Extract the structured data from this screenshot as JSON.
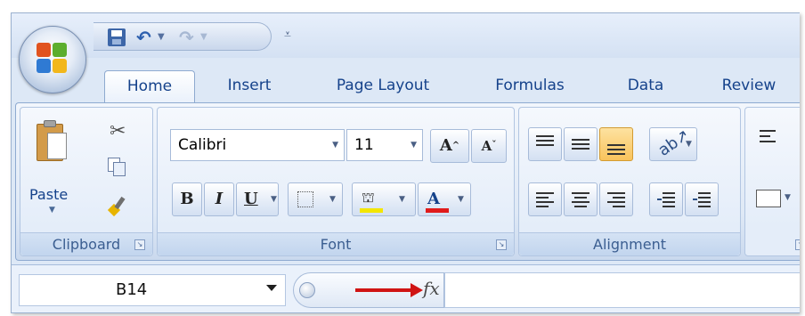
{
  "quick_access": {
    "customize_glyph": "₹"
  },
  "tabs": [
    {
      "label": "Home",
      "active": true
    },
    {
      "label": "Insert",
      "active": false
    },
    {
      "label": "Page Layout",
      "active": false
    },
    {
      "label": "Formulas",
      "active": false
    },
    {
      "label": "Data",
      "active": false
    },
    {
      "label": "Review",
      "active": false
    }
  ],
  "clipboard": {
    "group_label": "Clipboard",
    "paste_label": "Paste",
    "icons": [
      "paste-icon",
      "cut-icon",
      "copy-icon",
      "format-painter-icon"
    ]
  },
  "font": {
    "group_label": "Font",
    "font_name": "Calibri",
    "font_size": "11",
    "grow_label": "A",
    "shrink_label": "A",
    "bold_label": "B",
    "italic_label": "I",
    "underline_label": "U",
    "font_color_label": "A",
    "fill_color": "#f3e600",
    "font_color": "#e01b1b"
  },
  "alignment": {
    "group_label": "Alignment",
    "highlight_color": "#f9c35c"
  },
  "formula_bar": {
    "name_box_value": "B14",
    "fx_label": "fx",
    "formula_value": "",
    "arrow_color": "#d01414"
  }
}
